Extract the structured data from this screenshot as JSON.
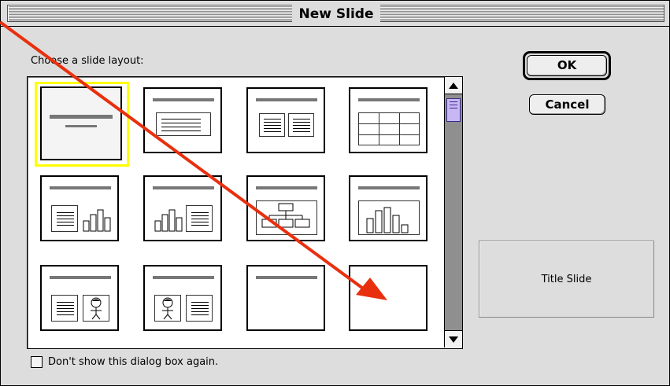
{
  "dialog": {
    "title": "New Slide",
    "prompt": "Choose a slide layout:",
    "ok_label": "OK",
    "cancel_label": "Cancel",
    "preview_label": "Title Slide",
    "checkbox_label": "Don't show this dialog box again.",
    "checkbox_checked": false
  },
  "layouts": [
    {
      "name": "title-slide",
      "selected": true
    },
    {
      "name": "bulleted-list"
    },
    {
      "name": "two-column-text"
    },
    {
      "name": "table"
    },
    {
      "name": "text-and-chart"
    },
    {
      "name": "chart-and-text"
    },
    {
      "name": "organization-chart"
    },
    {
      "name": "chart"
    },
    {
      "name": "text-and-clip-art"
    },
    {
      "name": "clip-art-and-text"
    },
    {
      "name": "title-only"
    },
    {
      "name": "blank"
    }
  ],
  "annotation": {
    "color": "#e8300f",
    "icon": "red-arrow-annotation"
  }
}
